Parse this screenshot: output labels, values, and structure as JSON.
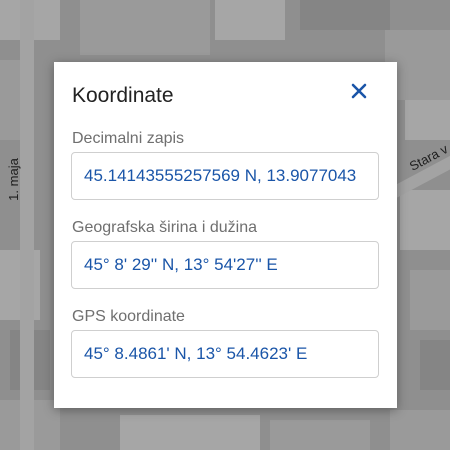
{
  "map": {
    "street_labels": [
      "1. maja",
      "Stara v"
    ]
  },
  "dialog": {
    "title": "Koordinate",
    "close_icon": "close-icon",
    "accent_color": "#1a55a8",
    "fields": [
      {
        "label": "Decimalni zapis",
        "value": "45.14143555257569 N, 13.9077043"
      },
      {
        "label": "Geografska širina i dužina",
        "value": "45° 8' 29'' N, 13° 54'27'' E"
      },
      {
        "label": "GPS koordinate",
        "value": "45° 8.4861' N, 13° 54.4623' E"
      }
    ]
  }
}
